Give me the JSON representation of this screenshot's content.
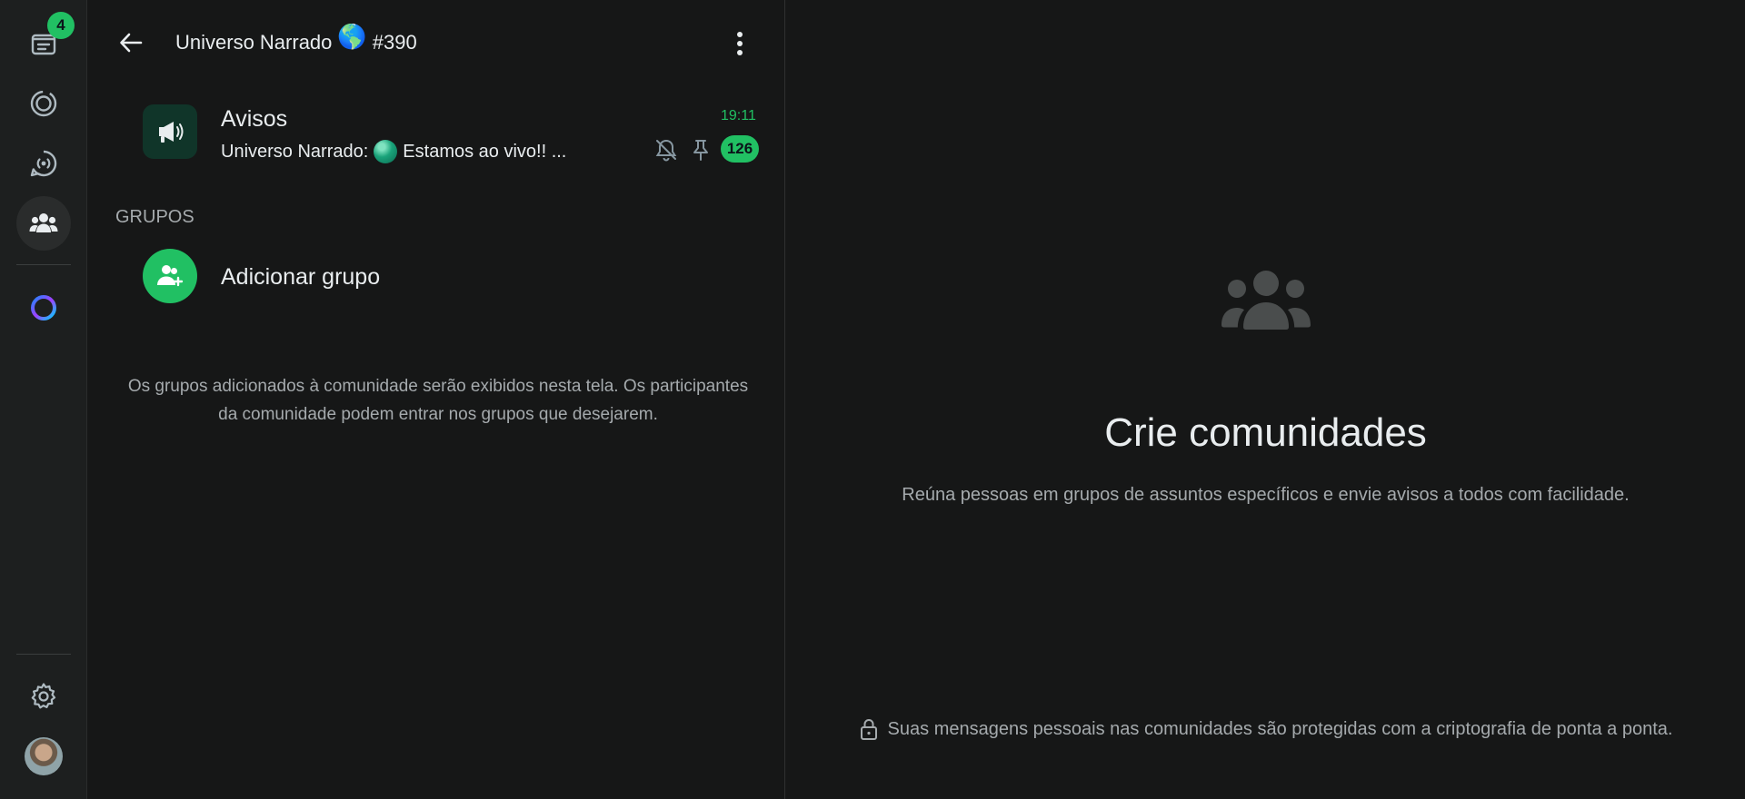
{
  "rail": {
    "chats_badge": "4",
    "icons": [
      "chats-icon",
      "status-icon",
      "channels-icon",
      "communities-icon",
      "meta-ai-icon",
      "settings-icon"
    ],
    "accent_color": "#21c063"
  },
  "header": {
    "community_name": "Universo Narrado",
    "emoji": "🌎",
    "suffix": "#390"
  },
  "announcements": {
    "name": "Avisos",
    "time": "19:11",
    "preview_sender": "Universo Narrado:",
    "preview_text": "Estamos ao vivo!! ...",
    "unread_count": "126"
  },
  "groups": {
    "header": "GRUPOS",
    "add_label": "Adicionar grupo",
    "info": "Os grupos adicionados à comunidade serão exibidos nesta tela. Os participantes da comunidade podem entrar nos grupos que desejarem."
  },
  "empty_state": {
    "title": "Crie comunidades",
    "subtitle": "Reúna pessoas em grupos de assuntos específicos e envie avisos a todos com facilidade.",
    "encryption_note": "Suas mensagens pessoais nas comunidades são protegidas com a criptografia de ponta a ponta."
  }
}
